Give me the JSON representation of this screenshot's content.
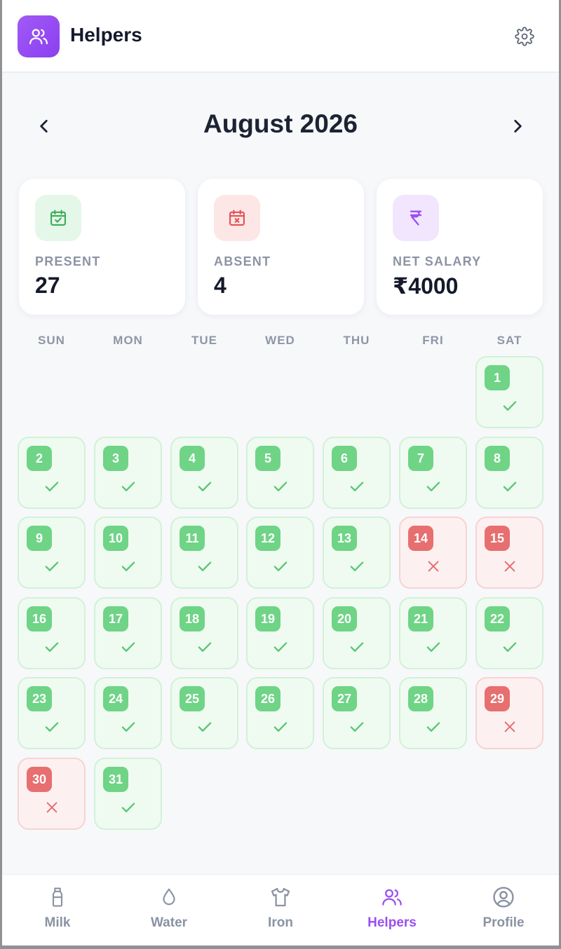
{
  "app": {
    "title": "Helpers",
    "brand_color": "#9b4ff2",
    "logo_icon": "users-icon",
    "settings_icon": "gear-icon"
  },
  "month_nav": {
    "title": "August 2026",
    "prev_icon": "chevron-left-icon",
    "next_icon": "chevron-right-icon"
  },
  "stats": [
    {
      "label": "PRESENT",
      "value": "27",
      "icon": "calendar-check-icon",
      "color": "#3daa5b",
      "bg": "#e4f7e8"
    },
    {
      "label": "ABSENT",
      "value": "4",
      "icon": "calendar-x-icon",
      "color": "#e05252",
      "bg": "#fde6e6"
    },
    {
      "label": "NET SALARY",
      "value": "₹4000",
      "icon": "rupee-icon",
      "color": "#9b4ff2",
      "bg": "#f1e6fe"
    }
  ],
  "calendar": {
    "weekdays": [
      "SUN",
      "MON",
      "TUE",
      "WED",
      "THU",
      "FRI",
      "SAT"
    ],
    "first_weekday_index": 6,
    "present_color": "#6fd486",
    "absent_color": "#e76f6f",
    "days": [
      {
        "day": "1",
        "status": "present"
      },
      {
        "day": "2",
        "status": "present"
      },
      {
        "day": "3",
        "status": "present"
      },
      {
        "day": "4",
        "status": "present"
      },
      {
        "day": "5",
        "status": "present"
      },
      {
        "day": "6",
        "status": "present"
      },
      {
        "day": "7",
        "status": "present"
      },
      {
        "day": "8",
        "status": "present"
      },
      {
        "day": "9",
        "status": "present"
      },
      {
        "day": "10",
        "status": "present"
      },
      {
        "day": "11",
        "status": "present"
      },
      {
        "day": "12",
        "status": "present"
      },
      {
        "day": "13",
        "status": "present"
      },
      {
        "day": "14",
        "status": "absent"
      },
      {
        "day": "15",
        "status": "absent"
      },
      {
        "day": "16",
        "status": "present"
      },
      {
        "day": "17",
        "status": "present"
      },
      {
        "day": "18",
        "status": "present"
      },
      {
        "day": "19",
        "status": "present"
      },
      {
        "day": "20",
        "status": "present"
      },
      {
        "day": "21",
        "status": "present"
      },
      {
        "day": "22",
        "status": "present"
      },
      {
        "day": "23",
        "status": "present"
      },
      {
        "day": "24",
        "status": "present"
      },
      {
        "day": "25",
        "status": "present"
      },
      {
        "day": "26",
        "status": "present"
      },
      {
        "day": "27",
        "status": "present"
      },
      {
        "day": "28",
        "status": "present"
      },
      {
        "day": "29",
        "status": "absent"
      },
      {
        "day": "30",
        "status": "absent"
      },
      {
        "day": "31",
        "status": "present"
      }
    ]
  },
  "bottom_nav": {
    "items": [
      {
        "label": "Milk",
        "icon": "milk-bottle-icon",
        "active": false
      },
      {
        "label": "Water",
        "icon": "water-drop-icon",
        "active": false
      },
      {
        "label": "Iron",
        "icon": "shirt-icon",
        "active": false
      },
      {
        "label": "Helpers",
        "icon": "users-icon",
        "active": true
      },
      {
        "label": "Profile",
        "icon": "user-circle-icon",
        "active": false
      }
    ]
  }
}
